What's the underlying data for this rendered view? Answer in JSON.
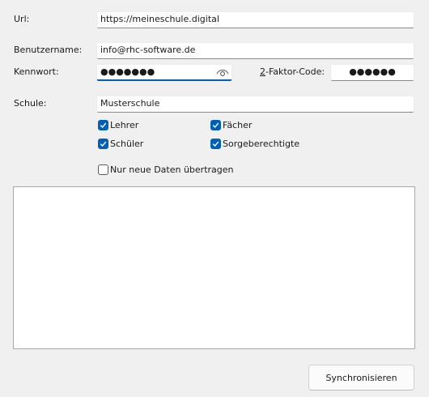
{
  "form": {
    "url": {
      "label": "Url:",
      "value": "https://meineschule.digital"
    },
    "username": {
      "label": "Benutzername:",
      "value": "info@rhc-software.de"
    },
    "password": {
      "label": "Kennwort:",
      "value": "●●●●●●●",
      "reveal_icon": "eye-icon"
    },
    "twofactor": {
      "label": "2-Faktor-Code:",
      "value": "●●●●●●"
    },
    "school": {
      "label": "Schule:",
      "value": "Musterschule"
    },
    "options": [
      {
        "label": "Lehrer",
        "checked": true
      },
      {
        "label": "Fächer",
        "checked": true
      },
      {
        "label": "Schüler",
        "checked": true
      },
      {
        "label": "Sorgeberechtigte",
        "checked": true
      }
    ],
    "only_new": {
      "label": "Nur neue Daten übertragen",
      "checked": false
    }
  },
  "actions": {
    "sync_label": "Synchronisieren"
  },
  "colors": {
    "accent": "#005fb8",
    "background": "#f0f0f0"
  }
}
